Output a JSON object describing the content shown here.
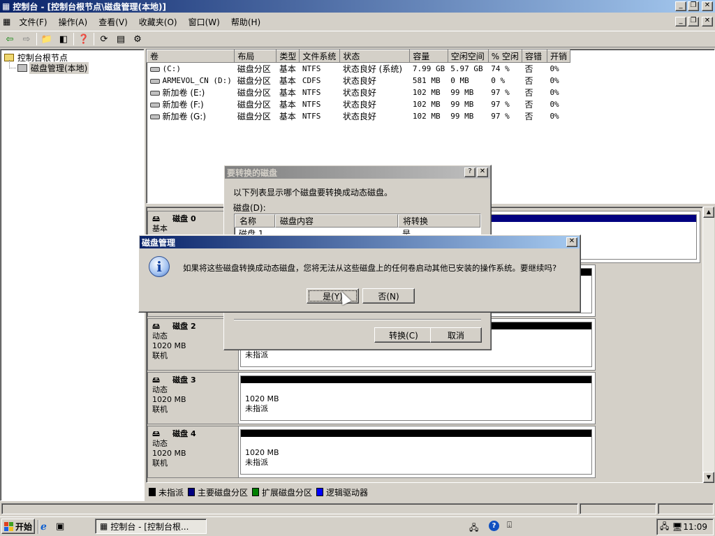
{
  "window": {
    "title": "控制台 - [控制台根节点\\磁盘管理(本地)]",
    "controls": [
      "_",
      "🗗",
      "✕"
    ]
  },
  "menu": [
    "文件(F)",
    "操作(A)",
    "查看(V)",
    "收藏夹(O)",
    "窗口(W)",
    "帮助(H)"
  ],
  "tree": {
    "root": "控制台根节点",
    "child": "磁盘管理(本地)"
  },
  "volumes": {
    "headers": [
      "卷",
      "布局",
      "类型",
      "文件系统",
      "状态",
      "容量",
      "空闲空间",
      "% 空闲",
      "容错",
      "开销"
    ],
    "rows": [
      [
        "(C:)",
        "磁盘分区",
        "基本",
        "NTFS",
        "状态良好 (系统)",
        "7.99 GB",
        "5.97 GB",
        "74 %",
        "否",
        "0%"
      ],
      [
        "ARMEVOL_CN (D:)",
        "磁盘分区",
        "基本",
        "CDFS",
        "状态良好",
        "581 MB",
        "0 MB",
        "0 %",
        "否",
        "0%"
      ],
      [
        "新加卷 (E:)",
        "磁盘分区",
        "基本",
        "NTFS",
        "状态良好",
        "102 MB",
        "99 MB",
        "97 %",
        "否",
        "0%"
      ],
      [
        "新加卷 (F:)",
        "磁盘分区",
        "基本",
        "NTFS",
        "状态良好",
        "102 MB",
        "99 MB",
        "97 %",
        "否",
        "0%"
      ],
      [
        "新加卷 (G:)",
        "磁盘分区",
        "基本",
        "NTFS",
        "状态良好",
        "102 MB",
        "99 MB",
        "97 %",
        "否",
        "0%"
      ]
    ]
  },
  "disks": [
    {
      "name": "磁盘 0",
      "type": "基本"
    },
    {
      "name": "磁盘 2",
      "type": "动态",
      "size": "1020 MB",
      "status": "联机",
      "part_label": "未指派"
    },
    {
      "name": "磁盘 3",
      "type": "动态",
      "size": "1020 MB",
      "status": "联机",
      "part_size": "1020 MB",
      "part_label": "未指派"
    },
    {
      "name": "磁盘 4",
      "type": "动态",
      "size": "1020 MB",
      "status": "联机",
      "part_size": "1020 MB",
      "part_label": "未指派"
    }
  ],
  "legend": [
    {
      "label": "未指派",
      "color": "#000000"
    },
    {
      "label": "主要磁盘分区",
      "color": "#000080"
    },
    {
      "label": "扩展磁盘分区",
      "color": "#008000"
    },
    {
      "label": "逻辑驱动器",
      "color": "#0000ff"
    }
  ],
  "convert_dialog": {
    "title": "要转换的磁盘",
    "description": "以下列表显示哪个磁盘要转换成动态磁盘。",
    "list_label": "磁盘(D):",
    "headers": [
      "名称",
      "磁盘内容",
      "将转换"
    ],
    "row": [
      "磁盘 1",
      "",
      "是"
    ],
    "convert_button": "转换(C)",
    "cancel_button": "取消"
  },
  "confirm_dialog": {
    "title": "磁盘管理",
    "message": "如果将这些磁盘转换成动态磁盘，您将无法从这些磁盘上的任何卷启动其他已安装的操作系统。要继续吗?",
    "yes_button": "是(Y)",
    "no_button": "否(N)"
  },
  "taskbar": {
    "start": "开始",
    "task": "控制台 - [控制台根...",
    "clock": "11:09"
  }
}
